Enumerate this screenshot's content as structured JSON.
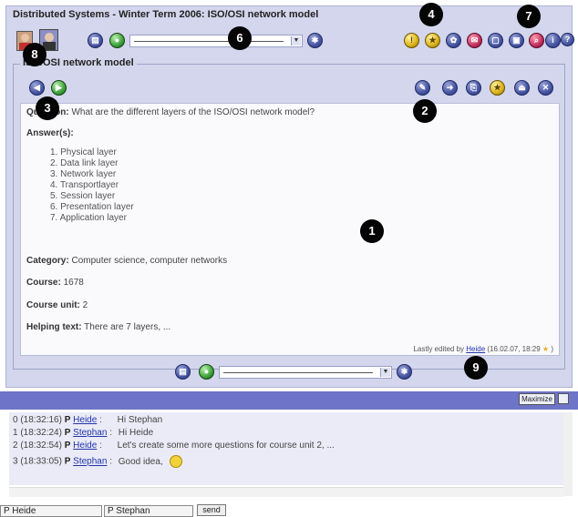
{
  "window": {
    "title": "Distributed Systems - Winter Term 2006: ISO/OSI network model"
  },
  "panel": {
    "legend": "ISO/OSI network model"
  },
  "question": {
    "label": "Question:",
    "text": "What are the different layers of the ISO/OSI network model?",
    "answers_label": "Answer(s):",
    "answers": [
      "1. Physical layer",
      "2. Data link layer",
      "3. Network layer",
      "4. Transportlayer",
      "5. Session layer",
      "6. Presentation layer",
      "7. Application layer"
    ],
    "category_label": "Category:",
    "category": "Computer science, computer networks",
    "course_label": "Course:",
    "course": "1678",
    "unit_label": "Course unit:",
    "unit": "2",
    "helping_label": "Helping text:",
    "helping": "There are 7 layers, ...",
    "edited_prefix": "Lastly edited by",
    "edited_by": "Heide",
    "edited_when": "(16.02.07, 18:29",
    "edited_suffix": ")"
  },
  "markers": [
    "1",
    "2",
    "3",
    "4",
    "5",
    "6",
    "7",
    "8",
    "9"
  ],
  "chat": {
    "maximize_label": "Maximize",
    "lines": [
      {
        "prefix": "0 (18:32:16)",
        "flag": "P",
        "user": "Heide",
        "sep": ":",
        "msg": "Hi Stephan"
      },
      {
        "prefix": "1 (18:32:24)",
        "flag": "P",
        "user": "Stephan",
        "sep": ":",
        "msg": "Hi Heide"
      },
      {
        "prefix": "2 (18:32:54)",
        "flag": "P",
        "user": "Heide",
        "sep": ":",
        "msg": "Let's create some more questions for course unit 2, ..."
      },
      {
        "prefix": "3 (18:33:05)",
        "flag": "P",
        "user": "Stephan",
        "sep": ":",
        "msg": "Good idea,"
      }
    ],
    "tabs": [
      "P Heide",
      "P Stephan"
    ],
    "send_label": "send"
  },
  "colors": {
    "frame": "#d3d6ec",
    "chatbar": "#6e74c8",
    "button": "#4b5aa6",
    "marker": "#050505"
  }
}
